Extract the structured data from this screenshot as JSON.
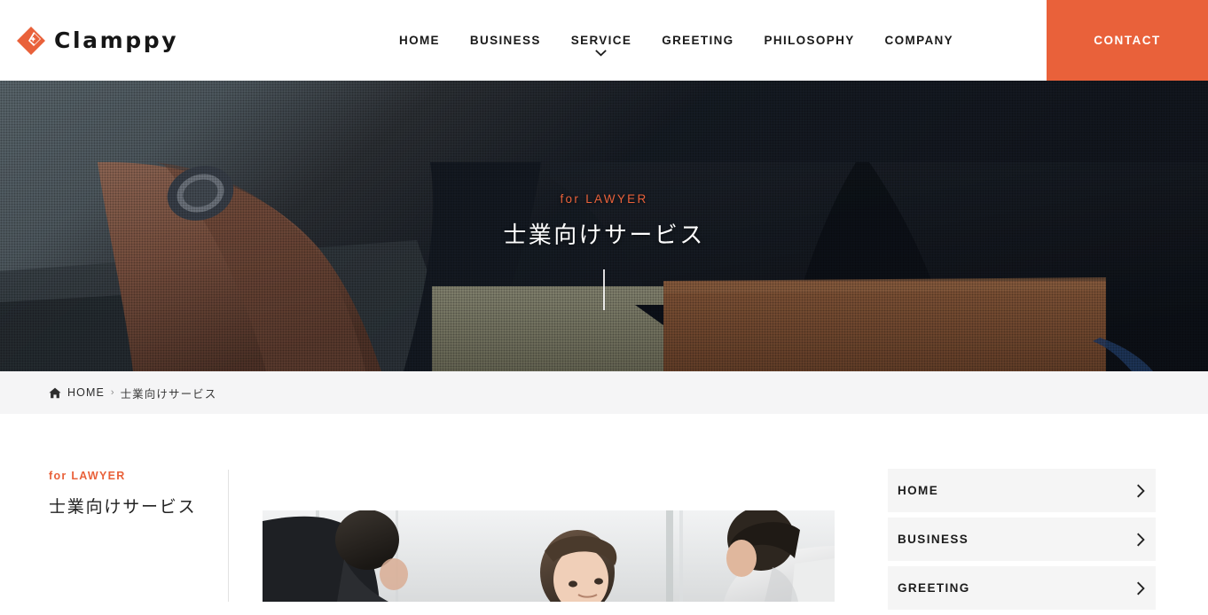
{
  "brand": {
    "name": "Clamppy",
    "logo_icon": "diamond-logo-icon",
    "accent_color": "#e9613a"
  },
  "header": {
    "nav_items": [
      {
        "label": "HOME",
        "has_dropdown": false
      },
      {
        "label": "BUSINESS",
        "has_dropdown": false
      },
      {
        "label": "SERVICE",
        "has_dropdown": true
      },
      {
        "label": "GREETING",
        "has_dropdown": false
      },
      {
        "label": "PHILOSOPHY",
        "has_dropdown": false
      },
      {
        "label": "COMPANY",
        "has_dropdown": false
      }
    ],
    "contact_label": "CONTACT"
  },
  "hero": {
    "eyebrow": "for LAWYER",
    "title": "士業向けサービス",
    "image_alt": "businessman-holding-documents-photo"
  },
  "breadcrumb": {
    "home_icon": "home-icon",
    "home_label": "HOME",
    "separator": "›",
    "current_label": "士業向けサービス"
  },
  "main": {
    "eyebrow": "for LAWYER",
    "title": "士業向けサービス",
    "feature_image_alt": "office-meeting-photo"
  },
  "sidebar": {
    "items": [
      {
        "label": "HOME",
        "chevron": "chevron-right-icon"
      },
      {
        "label": "BUSINESS",
        "chevron": "chevron-right-icon"
      },
      {
        "label": "GREETING",
        "chevron": "chevron-right-icon"
      }
    ]
  }
}
